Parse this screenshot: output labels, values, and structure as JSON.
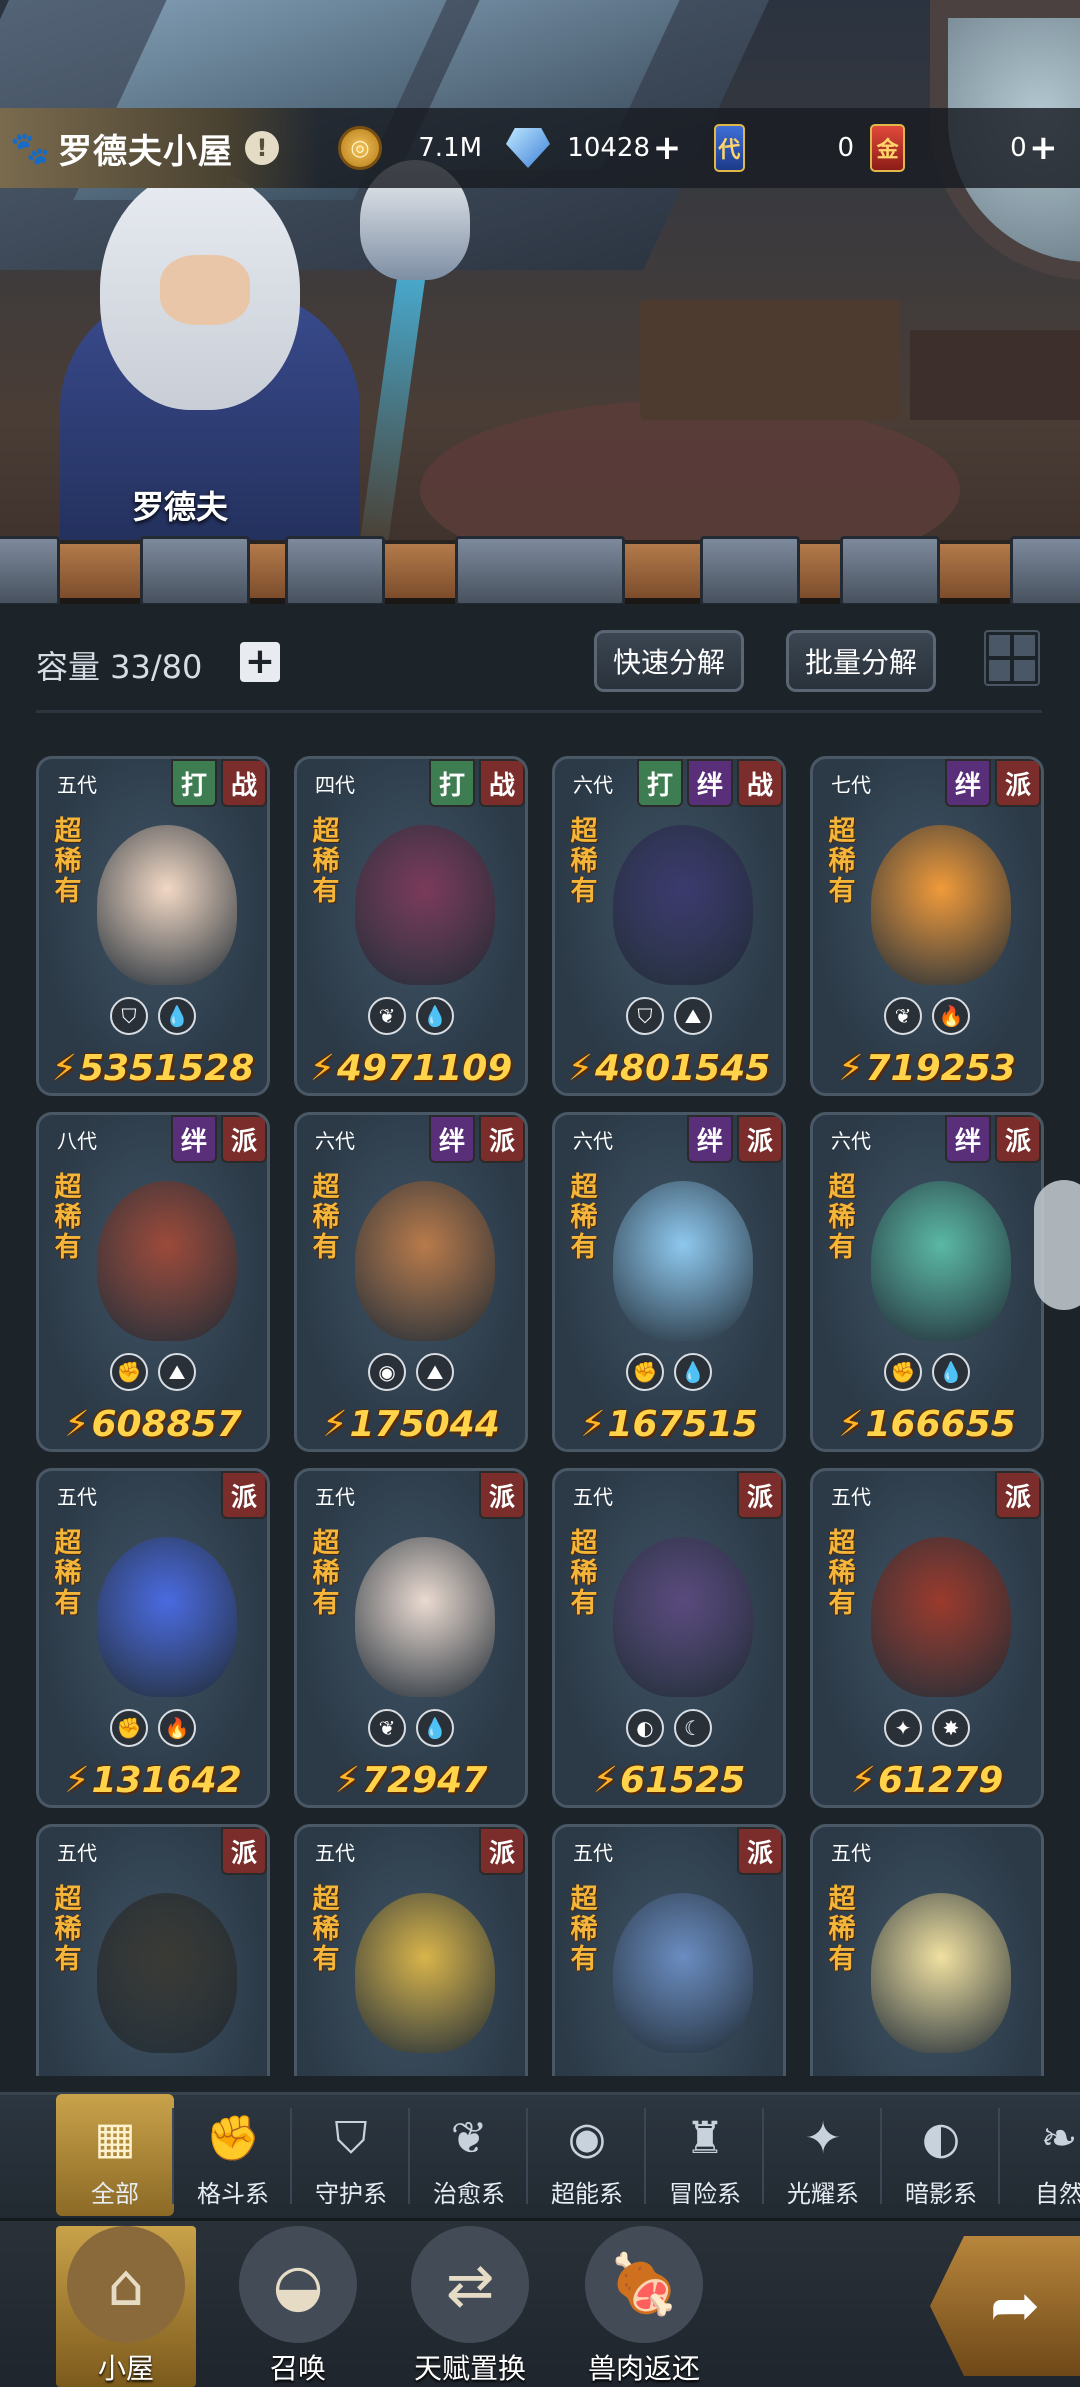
{
  "header": {
    "title": "罗德夫小屋",
    "info_badge": "!",
    "speaker_name": "罗德夫"
  },
  "resources": {
    "gold": {
      "icon": "gold-coin-icon",
      "value": "7.1M"
    },
    "crystal": {
      "icon": "crystal-icon",
      "value": "10428"
    },
    "ticket_blue": {
      "icon": "blue-ticket-icon",
      "glyph": "代",
      "value": "0"
    },
    "ticket_red": {
      "icon": "red-ticket-icon",
      "glyph": "金",
      "value": "0"
    }
  },
  "inventory": {
    "capacity_label": "容量 33/80",
    "quick_dismantle": "快速分解",
    "batch_dismantle": "批量分解"
  },
  "cards": [
    {
      "gen": "五代",
      "tags": [
        "打",
        "战"
      ],
      "rarity": "超稀有",
      "elements": [
        "guard-icon",
        "water-icon"
      ],
      "power": "5351528",
      "color": "#f2d8c4"
    },
    {
      "gen": "四代",
      "tags": [
        "打",
        "战"
      ],
      "rarity": "超稀有",
      "elements": [
        "heal-icon",
        "water-icon"
      ],
      "power": "4971109",
      "color": "#7a3a5a"
    },
    {
      "gen": "六代",
      "tags": [
        "打",
        "绊",
        "战"
      ],
      "rarity": "超稀有",
      "elements": [
        "guard-icon",
        "earth-icon"
      ],
      "power": "4801545",
      "color": "#3c3a6e"
    },
    {
      "gen": "七代",
      "tags": [
        "绊",
        "派"
      ],
      "rarity": "超稀有",
      "elements": [
        "heal-icon",
        "fire-icon"
      ],
      "power": "719253",
      "color": "#f09a3a"
    },
    {
      "gen": "八代",
      "tags": [
        "绊",
        "派"
      ],
      "rarity": "超稀有",
      "elements": [
        "fist-icon",
        "earth-icon"
      ],
      "power": "608857",
      "color": "#9c4a3a"
    },
    {
      "gen": "六代",
      "tags": [
        "绊",
        "派"
      ],
      "rarity": "超稀有",
      "elements": [
        "psychic-icon",
        "earth-icon"
      ],
      "power": "175044",
      "color": "#b87a4a"
    },
    {
      "gen": "六代",
      "tags": [
        "绊",
        "派"
      ],
      "rarity": "超稀有",
      "elements": [
        "fist-icon",
        "water-icon"
      ],
      "power": "167515",
      "color": "#8ec8ee"
    },
    {
      "gen": "六代",
      "tags": [
        "绊",
        "派"
      ],
      "rarity": "超稀有",
      "elements": [
        "fist-icon",
        "water-icon"
      ],
      "power": "166655",
      "color": "#5ab8a4"
    },
    {
      "gen": "五代",
      "tags": [
        "派"
      ],
      "rarity": "超稀有",
      "elements": [
        "fist-icon",
        "fire-icon"
      ],
      "power": "131642",
      "color": "#4a6ae0"
    },
    {
      "gen": "五代",
      "tags": [
        "派"
      ],
      "rarity": "超稀有",
      "elements": [
        "heal-icon",
        "water-icon"
      ],
      "power": "72947",
      "color": "#eadad0"
    },
    {
      "gen": "五代",
      "tags": [
        "派"
      ],
      "rarity": "超稀有",
      "elements": [
        "shadow-icon",
        "dark-icon"
      ],
      "power": "61525",
      "color": "#5a4a7e"
    },
    {
      "gen": "五代",
      "tags": [
        "派"
      ],
      "rarity": "超稀有",
      "elements": [
        "light-icon",
        "sun-icon"
      ],
      "power": "61279",
      "color": "#9a3a2c"
    },
    {
      "gen": "五代",
      "tags": [
        "派"
      ],
      "rarity": "超稀有",
      "elements": [],
      "power": "",
      "color": "#3a3a34"
    },
    {
      "gen": "五代",
      "tags": [
        "派"
      ],
      "rarity": "超稀有",
      "elements": [],
      "power": "",
      "color": "#d8b44a"
    },
    {
      "gen": "五代",
      "tags": [
        "派"
      ],
      "rarity": "超稀有",
      "elements": [],
      "power": "",
      "color": "#6a8cc0"
    },
    {
      "gen": "五代",
      "tags": [],
      "rarity": "超稀有",
      "elements": [],
      "power": "",
      "color": "#f0e0a0"
    }
  ],
  "filters": [
    {
      "label": "全部",
      "icon": "all-icon",
      "glyph": "▦",
      "active": true
    },
    {
      "label": "格斗系",
      "icon": "fist-icon",
      "glyph": "✊",
      "active": false
    },
    {
      "label": "守护系",
      "icon": "shield-icon",
      "glyph": "⛉",
      "active": false
    },
    {
      "label": "治愈系",
      "icon": "sprout-icon",
      "glyph": "❦",
      "active": false
    },
    {
      "label": "超能系",
      "icon": "psychic-icon",
      "glyph": "◉",
      "active": false
    },
    {
      "label": "冒险系",
      "icon": "adventure-icon",
      "glyph": "♜",
      "active": false
    },
    {
      "label": "光耀系",
      "icon": "light-icon",
      "glyph": "✦",
      "active": false
    },
    {
      "label": "暗影系",
      "icon": "shadow-icon",
      "glyph": "◐",
      "active": false
    },
    {
      "label": "自然",
      "icon": "nature-icon",
      "glyph": "❧",
      "active": false
    }
  ],
  "nav": [
    {
      "label": "小屋",
      "icon": "house-icon",
      "glyph": "⌂",
      "active": true
    },
    {
      "label": "召唤",
      "icon": "egg-icon",
      "glyph": "◒",
      "active": false
    },
    {
      "label": "天赋置换",
      "icon": "swap-icon",
      "glyph": "⇄",
      "active": false
    },
    {
      "label": "兽肉返还",
      "icon": "meat-icon",
      "glyph": "🍖",
      "active": false
    }
  ],
  "colors": {
    "gold": "#ffd44a",
    "rarity": "#f4b63a",
    "active_tab": "#c9a24a"
  }
}
